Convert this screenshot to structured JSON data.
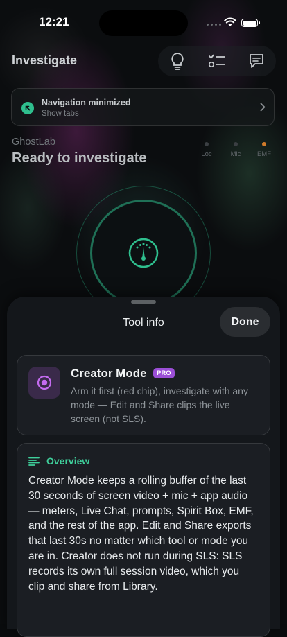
{
  "status_bar": {
    "time": "12:21"
  },
  "header": {
    "title": "Investigate",
    "icons": [
      "lightbulb-icon",
      "checklist-icon",
      "chat-icon"
    ]
  },
  "nav_banner": {
    "title": "Navigation minimized",
    "subtitle": "Show tabs"
  },
  "session": {
    "app_name": "GhostLab",
    "status": "Ready to investigate",
    "indicators": [
      {
        "label": "Loc",
        "active": false
      },
      {
        "label": "Mic",
        "active": false
      },
      {
        "label": "EMF",
        "active": true
      }
    ]
  },
  "sheet": {
    "title": "Tool info",
    "done_label": "Done",
    "tool": {
      "name": "Creator Mode",
      "badge": "PRO",
      "summary": "Arm it first (red chip), investigate with any mode — Edit and Share clips the live screen (not SLS)."
    },
    "overview": {
      "heading": "Overview",
      "body": "Creator Mode keeps a rolling buffer of the last 30 seconds of screen video + mic + app audio — meters, Live Chat, prompts, Spirit Box, EMF, and the rest of the app. Edit and Share exports that last 30s no matter which tool or mode you are in. Creator does not run during SLS: SLS records its own full session video, which you clip and share from Library."
    }
  },
  "colors": {
    "accent_green": "#2fbf8e",
    "pro_purple": "#9b4fd6",
    "emf_orange": "#d07a2a"
  }
}
